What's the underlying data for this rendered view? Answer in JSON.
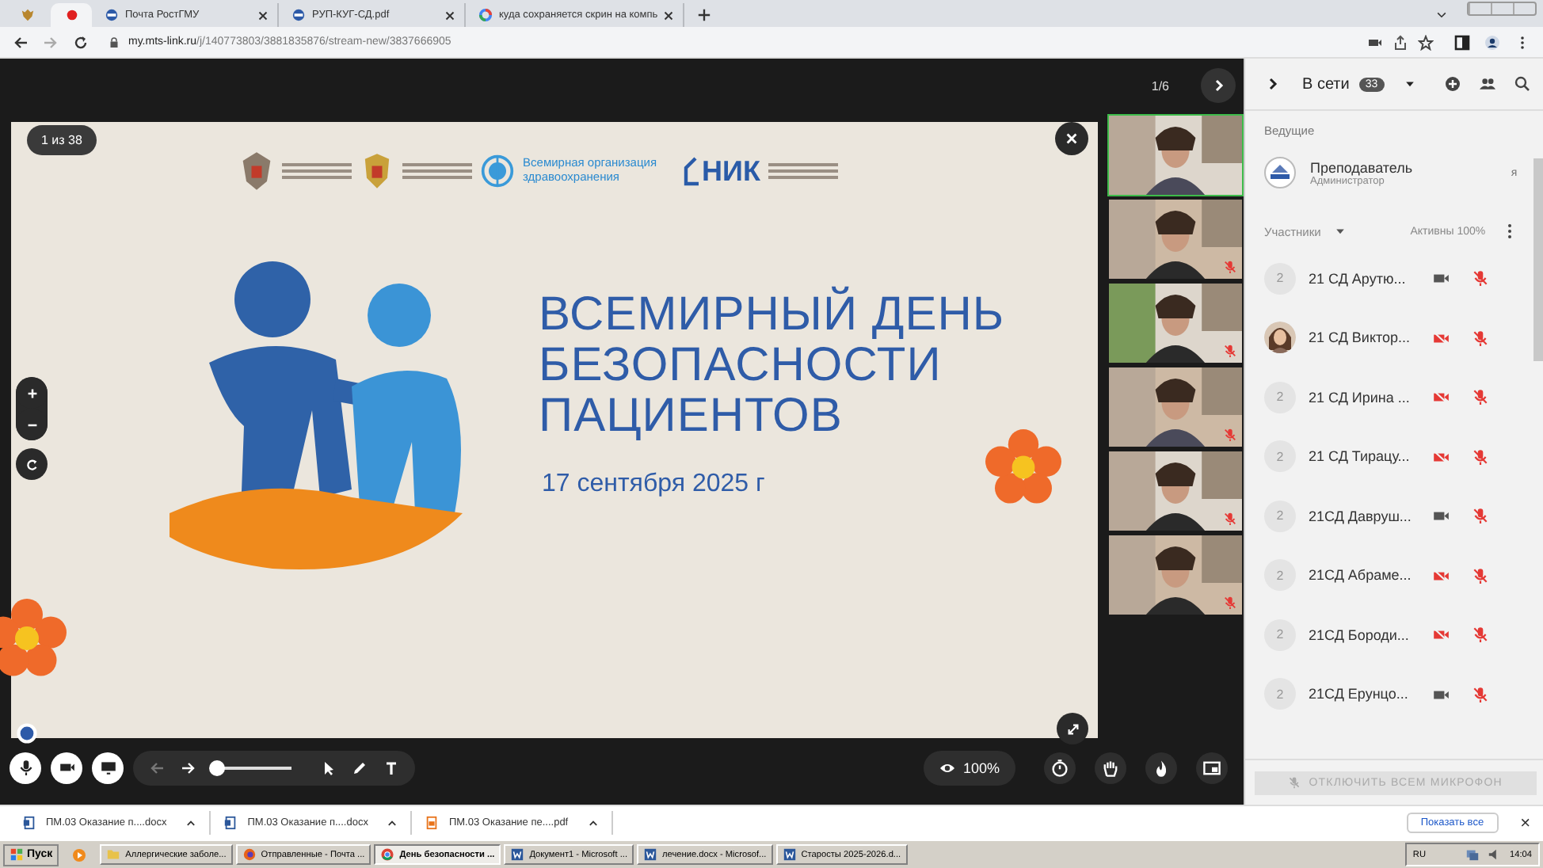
{
  "browser": {
    "tabs": [
      {
        "kind": "emblem",
        "selected": false
      },
      {
        "kind": "record",
        "selected": true
      },
      {
        "label": "Почта РостГМУ",
        "kind": "site",
        "selected": false
      },
      {
        "label": "РУП-КУГ-СД.pdf",
        "kind": "site",
        "selected": false
      },
      {
        "label": "куда сохраняется скрин на компь",
        "kind": "google",
        "selected": false
      }
    ],
    "address": {
      "host": "my.mts-link.ru",
      "path": "/j/140773803/3881835876/stream-new/3837666905"
    }
  },
  "stage": {
    "page_counter": "1/6",
    "slide": {
      "counter": "1 из 38",
      "who_text": "Всемирная организация здравоохранения",
      "nik_text": "НИК",
      "title_lines": [
        "ВСЕМИРНЫЙ ДЕНЬ",
        "БЕЗОПАСНОСТИ",
        "ПАЦИЕНТОВ"
      ],
      "date": "17 сентября 2025 г"
    },
    "videos": [
      {
        "selected": true,
        "mic_on": true
      },
      {
        "selected": false,
        "mic_on": false
      },
      {
        "selected": false,
        "mic_on": false
      },
      {
        "selected": false,
        "mic_on": false
      },
      {
        "selected": false,
        "mic_on": false
      },
      {
        "selected": false,
        "mic_on": false
      }
    ],
    "toolbar": {
      "brush": {
        "level": 0
      },
      "view_percent": "100%"
    }
  },
  "sidebar": {
    "title": "В сети",
    "count": "33",
    "hosts_heading": "Ведущие",
    "host": {
      "name": "Преподаватель",
      "role": "Администратор",
      "me": "я"
    },
    "participants_heading": "Участники",
    "active": "Активны 100%",
    "participants": [
      {
        "avatar": "2",
        "kind": "initial",
        "name": "21 СД Арутю...",
        "camera_on": true,
        "mic_on": false
      },
      {
        "kind": "picture",
        "name": "21 СД Виктор...",
        "camera_on": false,
        "mic_on": false
      },
      {
        "avatar": "2",
        "kind": "initial",
        "name": "21 СД Ирина ...",
        "camera_on": false,
        "mic_on": false
      },
      {
        "avatar": "2",
        "kind": "initial",
        "name": "21 СД Тирацу...",
        "camera_on": false,
        "mic_on": false
      },
      {
        "avatar": "2",
        "kind": "initial",
        "name": "21СД Давруш...",
        "camera_on": true,
        "mic_on": false
      },
      {
        "avatar": "2",
        "kind": "initial",
        "name": "21СД Абраме...",
        "camera_on": false,
        "mic_on": false
      },
      {
        "avatar": "2",
        "kind": "initial",
        "name": "21СД Бороди...",
        "camera_on": false,
        "mic_on": false
      },
      {
        "avatar": "2",
        "kind": "initial",
        "name": "21СД Ерунцо...",
        "camera_on": true,
        "mic_on": false
      }
    ],
    "mute_all": {
      "label": "ОТКЛЮЧИТЬ ВСЕМ МИКРОФОН",
      "disabled": true
    }
  },
  "downloads": {
    "items": [
      {
        "name": "ПМ.03 Оказание п....docx",
        "kind": "word"
      },
      {
        "name": "ПМ.03 Оказание п....docx",
        "kind": "word"
      },
      {
        "name": "ПМ.03 Оказание пе....pdf",
        "kind": "pdf"
      }
    ],
    "show_all": "Показать все",
    "close": "×"
  },
  "taskbar": {
    "start": "Пуск",
    "items": [
      {
        "label": "Аллергические заболе...",
        "kind": "folder",
        "selected": false
      },
      {
        "label": "Отправленные - Почта ...",
        "kind": "firefox",
        "selected": false
      },
      {
        "label": "День безопасности ...",
        "kind": "chrome",
        "selected": true
      },
      {
        "label": "Документ1 - Microsoft ...",
        "kind": "word",
        "selected": false
      },
      {
        "label": "лечение.docx - Microsof...",
        "kind": "word",
        "selected": false
      },
      {
        "label": "Старосты 2025-2026.d...",
        "kind": "word",
        "selected": false
      }
    ],
    "lang": "RU",
    "time": "14:04"
  }
}
